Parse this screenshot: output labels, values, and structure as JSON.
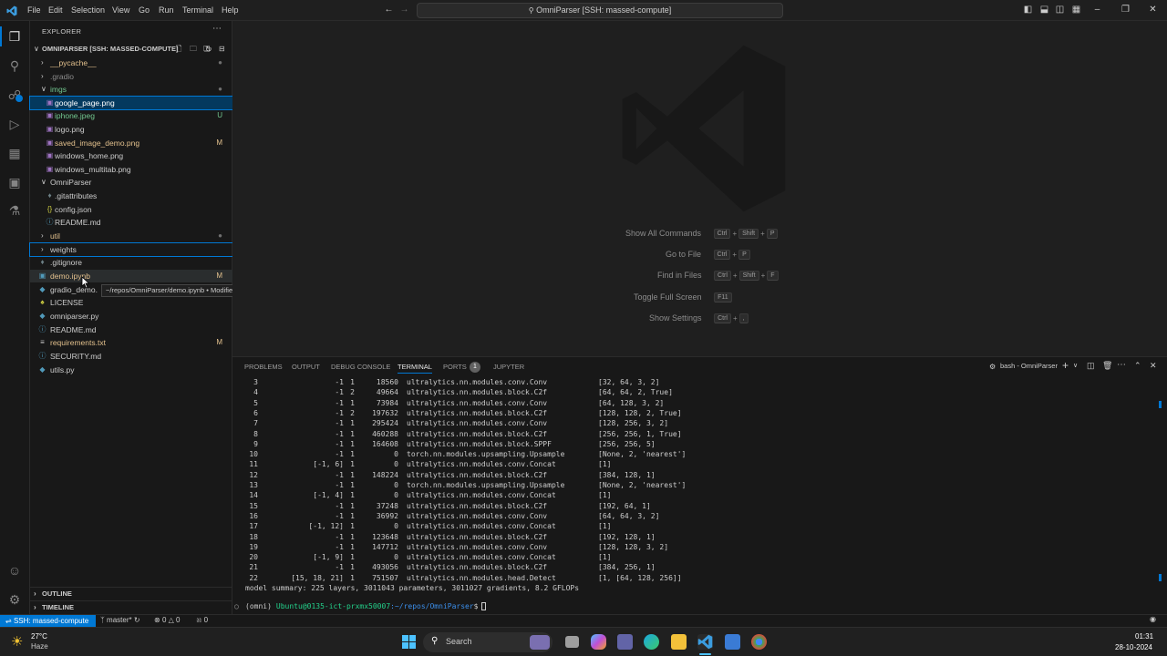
{
  "menu": [
    "File",
    "Edit",
    "Selection",
    "View",
    "Go",
    "Run",
    "Terminal",
    "Help"
  ],
  "search": {
    "text": "OmniParser [SSH: massed-compute]"
  },
  "explorer": {
    "title": "EXPLORER",
    "root": "OMNIPARSER [SSH: MASSED-COMPUTE]",
    "items": [
      {
        "label": "__pycache__",
        "status": ""
      },
      {
        "label": ".gradio",
        "status": ""
      },
      {
        "label": "imgs",
        "status": ""
      },
      {
        "label": "google_page.png",
        "status": ""
      },
      {
        "label": "iphone.jpeg",
        "status": "U"
      },
      {
        "label": "logo.png",
        "status": ""
      },
      {
        "label": "saved_image_demo.png",
        "status": "M"
      },
      {
        "label": "windows_home.png",
        "status": ""
      },
      {
        "label": "windows_multitab.png",
        "status": ""
      },
      {
        "label": "OmniParser",
        "status": ""
      },
      {
        "label": ".gitattributes",
        "status": ""
      },
      {
        "label": "config.json",
        "status": ""
      },
      {
        "label": "README.md",
        "status": ""
      },
      {
        "label": "util",
        "status": ""
      },
      {
        "label": "weights",
        "status": ""
      },
      {
        "label": ".gitignore",
        "status": ""
      },
      {
        "label": "demo.ipynb",
        "status": "M"
      },
      {
        "label": "gradio_demo.",
        "status": ""
      },
      {
        "label": "LICENSE",
        "status": ""
      },
      {
        "label": "omniparser.py",
        "status": ""
      },
      {
        "label": "README.md",
        "status": ""
      },
      {
        "label": "requirements.txt",
        "status": "M"
      },
      {
        "label": "SECURITY.md",
        "status": ""
      },
      {
        "label": "utils.py",
        "status": ""
      }
    ],
    "tooltip": "~/repos/OmniParser/demo.ipynb • Modified",
    "outline": "OUTLINE",
    "timeline": "TIMELINE"
  },
  "shortcuts": [
    {
      "label": "Show All Commands",
      "keys": [
        "Ctrl",
        "Shift",
        "P"
      ]
    },
    {
      "label": "Go to File",
      "keys": [
        "Ctrl",
        "P"
      ]
    },
    {
      "label": "Find in Files",
      "keys": [
        "Ctrl",
        "Shift",
        "F"
      ]
    },
    {
      "label": "Toggle Full Screen",
      "keys": [
        "F11"
      ]
    },
    {
      "label": "Show Settings",
      "keys": [
        "Ctrl",
        ","
      ]
    }
  ],
  "panel": {
    "tabs": [
      "PROBLEMS",
      "OUTPUT",
      "DEBUG CONSOLE",
      "TERMINAL",
      "PORTS",
      "JUPYTER"
    ],
    "active_tab": "TERMINAL",
    "ports_badge": "1",
    "terminal_name": "bash - OmniParser"
  },
  "terminal": {
    "rows": [
      [
        "3",
        "-1",
        "1",
        "18560",
        "ultralytics.nn.modules.conv.Conv",
        "[32, 64, 3, 2]"
      ],
      [
        "4",
        "-1",
        "2",
        "49664",
        "ultralytics.nn.modules.block.C2f",
        "[64, 64, 2, True]"
      ],
      [
        "5",
        "-1",
        "1",
        "73984",
        "ultralytics.nn.modules.conv.Conv",
        "[64, 128, 3, 2]"
      ],
      [
        "6",
        "-1",
        "2",
        "197632",
        "ultralytics.nn.modules.block.C2f",
        "[128, 128, 2, True]"
      ],
      [
        "7",
        "-1",
        "1",
        "295424",
        "ultralytics.nn.modules.conv.Conv",
        "[128, 256, 3, 2]"
      ],
      [
        "8",
        "-1",
        "1",
        "460288",
        "ultralytics.nn.modules.block.C2f",
        "[256, 256, 1, True]"
      ],
      [
        "9",
        "-1",
        "1",
        "164608",
        "ultralytics.nn.modules.block.SPPF",
        "[256, 256, 5]"
      ],
      [
        "10",
        "-1",
        "1",
        "0",
        "torch.nn.modules.upsampling.Upsample",
        "[None, 2, 'nearest']"
      ],
      [
        "11",
        "[-1, 6]",
        "1",
        "0",
        "ultralytics.nn.modules.conv.Concat",
        "[1]"
      ],
      [
        "12",
        "-1",
        "1",
        "148224",
        "ultralytics.nn.modules.block.C2f",
        "[384, 128, 1]"
      ],
      [
        "13",
        "-1",
        "1",
        "0",
        "torch.nn.modules.upsampling.Upsample",
        "[None, 2, 'nearest']"
      ],
      [
        "14",
        "[-1, 4]",
        "1",
        "0",
        "ultralytics.nn.modules.conv.Concat",
        "[1]"
      ],
      [
        "15",
        "-1",
        "1",
        "37248",
        "ultralytics.nn.modules.block.C2f",
        "[192, 64, 1]"
      ],
      [
        "16",
        "-1",
        "1",
        "36992",
        "ultralytics.nn.modules.conv.Conv",
        "[64, 64, 3, 2]"
      ],
      [
        "17",
        "[-1, 12]",
        "1",
        "0",
        "ultralytics.nn.modules.conv.Concat",
        "[1]"
      ],
      [
        "18",
        "-1",
        "1",
        "123648",
        "ultralytics.nn.modules.block.C2f",
        "[192, 128, 1]"
      ],
      [
        "19",
        "-1",
        "1",
        "147712",
        "ultralytics.nn.modules.conv.Conv",
        "[128, 128, 3, 2]"
      ],
      [
        "20",
        "[-1, 9]",
        "1",
        "0",
        "ultralytics.nn.modules.conv.Concat",
        "[1]"
      ],
      [
        "21",
        "-1",
        "1",
        "493056",
        "ultralytics.nn.modules.block.C2f",
        "[384, 256, 1]"
      ],
      [
        "22",
        "[15, 18, 21]",
        "1",
        "751507",
        "ultralytics.nn.modules.head.Detect",
        "[1, [64, 128, 256]]"
      ]
    ],
    "summary": "model summary: 225 layers, 3011043 parameters, 3011027 gradients, 8.2 GFLOPs",
    "prompt_env": "(omni)",
    "prompt_user": "Ubuntu@0135-ict-prxmx50007",
    "prompt_path": ":~/repos/OmniParser",
    "prompt_symbol": "$"
  },
  "statusbar": {
    "remote": "SSH: massed-compute",
    "branch": "master*",
    "errors": "0",
    "warnings": "0",
    "ports": "0"
  },
  "taskbar": {
    "weather_temp": "27°C",
    "weather_desc": "Haze",
    "search": "Search",
    "time": "01:31",
    "date": "28-10-2024"
  },
  "colors": {
    "accent": "#0078d4",
    "modified": "#e2c08d",
    "untracked": "#73c991",
    "selection": "#04395e"
  }
}
